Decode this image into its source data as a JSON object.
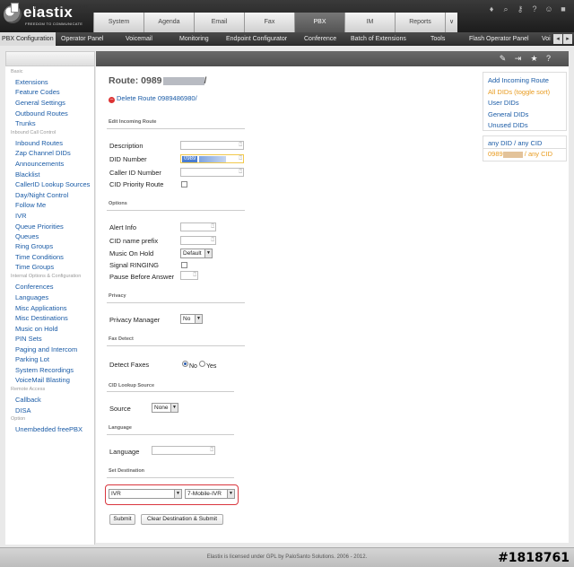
{
  "header": {
    "logo_text": "elastix",
    "logo_tagline": "FREEDOM TO COMMUNICATE",
    "main_tabs": [
      "System",
      "Agenda",
      "Email",
      "Fax",
      "PBX",
      "IM",
      "Reports"
    ],
    "active_tab": "PBX",
    "more_tab": "∨"
  },
  "subnav": {
    "items": [
      "PBX Configuration",
      "Operator Panel",
      "Voicemail",
      "Monitoring",
      "Endpoint Configurator",
      "Conference",
      "Batch of Extensions",
      "Tools",
      "Flash Operator Panel",
      "Voi"
    ],
    "active": "PBX Configuration"
  },
  "sidebar": {
    "title": "PBX Configuration",
    "groups": [
      {
        "category": "Basic",
        "items": [
          "Extensions",
          "Feature Codes",
          "General Settings",
          "Outbound Routes",
          "Trunks"
        ]
      },
      {
        "category": "Inbound Call Control",
        "items": [
          "Inbound Routes",
          "Zap Channel DIDs",
          "Announcements",
          "Blacklist",
          "CallerID Lookup Sources",
          "Day/Night Control",
          "Follow Me",
          "IVR",
          "Queue Priorities",
          "Queues",
          "Ring Groups",
          "Time Conditions",
          "Time Groups"
        ]
      },
      {
        "category": "Internal Options & Configuration",
        "items": [
          "Conferences",
          "Languages",
          "Misc Applications",
          "Misc Destinations",
          "Music on Hold",
          "PIN Sets",
          "Paging and Intercom",
          "Parking Lot",
          "System Recordings",
          "VoiceMail Blasting"
        ]
      },
      {
        "category": "Remote Access",
        "items": [
          "Callback",
          "DISA"
        ]
      },
      {
        "category": "Option",
        "items": [
          "Unembedded freePBX"
        ]
      }
    ]
  },
  "main": {
    "title": "Route: 0989",
    "title_suffix": "/",
    "delete_link": "Delete Route 0989486980/",
    "sections": {
      "edit": "Edit Incoming Route",
      "options": "Options",
      "privacy": "Privacy",
      "fax": "Fax Detect",
      "cid_lookup": "CID Lookup Source",
      "language": "Language",
      "destination": "Set Destination"
    },
    "labels": {
      "description": "Description",
      "did_number": "DID Number",
      "caller_id_number": "Caller ID Number",
      "cid_priority": "CID Priority Route",
      "alert_info": "Alert Info",
      "cid_prefix": "CID name prefix",
      "music_on_hold": "Music On Hold",
      "signal_ringing": "Signal RINGING",
      "pause_before_answer": "Pause Before Answer",
      "privacy_manager": "Privacy Manager",
      "detect_faxes": "Detect Faxes",
      "source": "Source",
      "language": "Language"
    },
    "values": {
      "did_number": "0989",
      "music_on_hold": "Default",
      "privacy_manager": "No",
      "detect_faxes_no": "No",
      "detect_faxes_yes": "Yes",
      "source": "None",
      "destination_type": "IVR",
      "destination_target": "7-Mobile-IVR"
    },
    "buttons": {
      "submit": "Submit",
      "clear_submit": "Clear Destination & Submit"
    }
  },
  "right_panel": {
    "items": [
      "Add Incoming Route",
      "All DIDs (toggle sort)",
      "User DIDs",
      "General DIDs",
      "Unused DIDs"
    ],
    "routes": [
      "any DID / any CID",
      "0989",
      " / any CID"
    ]
  },
  "footer": {
    "text": "Elastix is licensed under GPL by PaloSanto Solutions. 2006 - 2012.",
    "watermark": "#1818761"
  },
  "colors": {
    "link": "#1a5ba6",
    "accent_orange": "#e89b1f",
    "highlight_red": "#d9363e",
    "header_dark": "#2a2a2a"
  }
}
